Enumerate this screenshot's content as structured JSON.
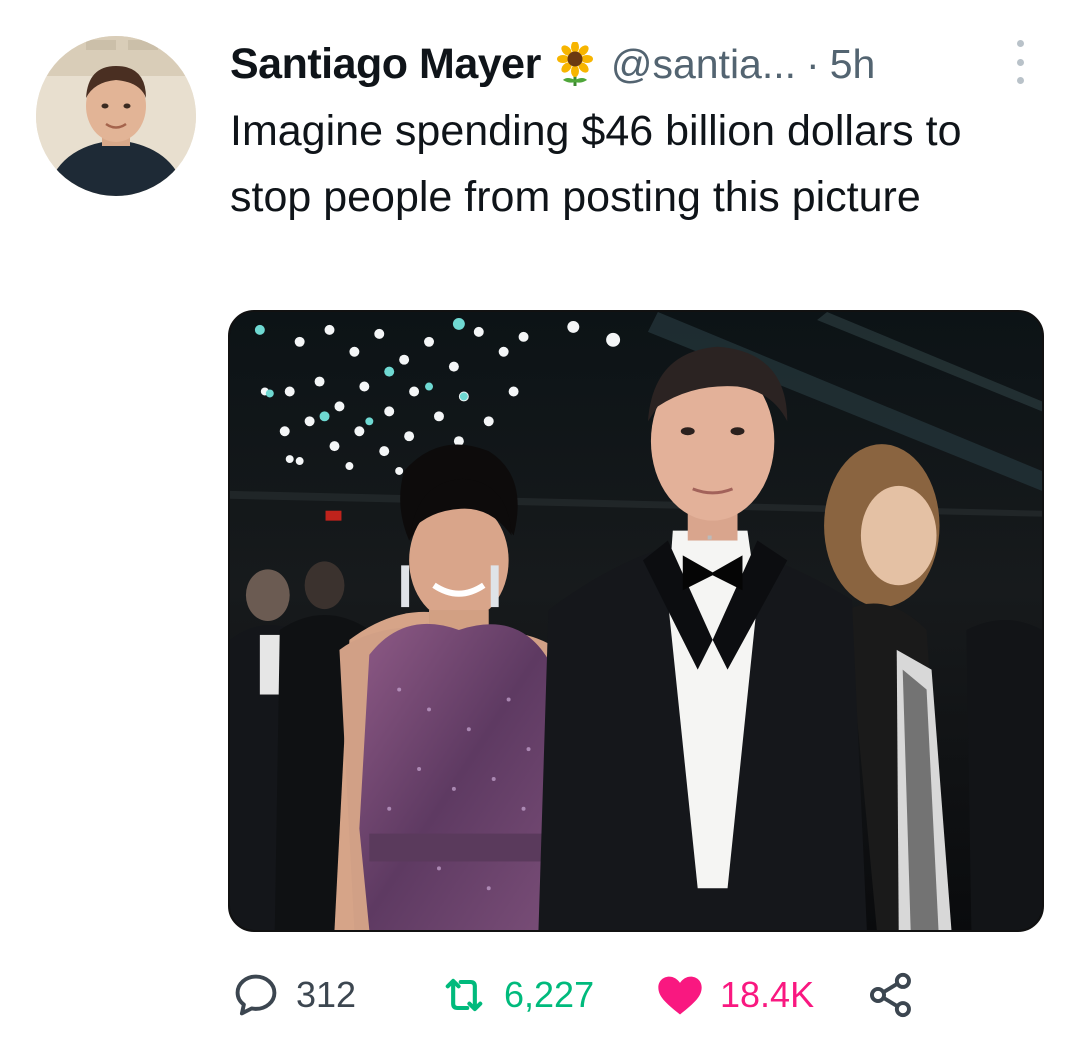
{
  "author": {
    "display_name": "Santiago Mayer",
    "badge_icon": "sunflower-icon",
    "handle": "@santia...",
    "separator": "·",
    "time_ago": "5h"
  },
  "tweet": {
    "text": "Imagine spending $46 billion dollars to stop people from posting this picture"
  },
  "actions": {
    "reply": {
      "icon": "reply-icon",
      "count": "312"
    },
    "retweet": {
      "icon": "retweet-icon",
      "count": "6,227"
    },
    "like": {
      "icon": "heart-icon",
      "count": "18.4K"
    },
    "share": {
      "icon": "share-icon"
    }
  },
  "colors": {
    "text": "#0f1419",
    "secondary": "#536471",
    "retweet": "#00ba7c",
    "like": "#f91880"
  }
}
